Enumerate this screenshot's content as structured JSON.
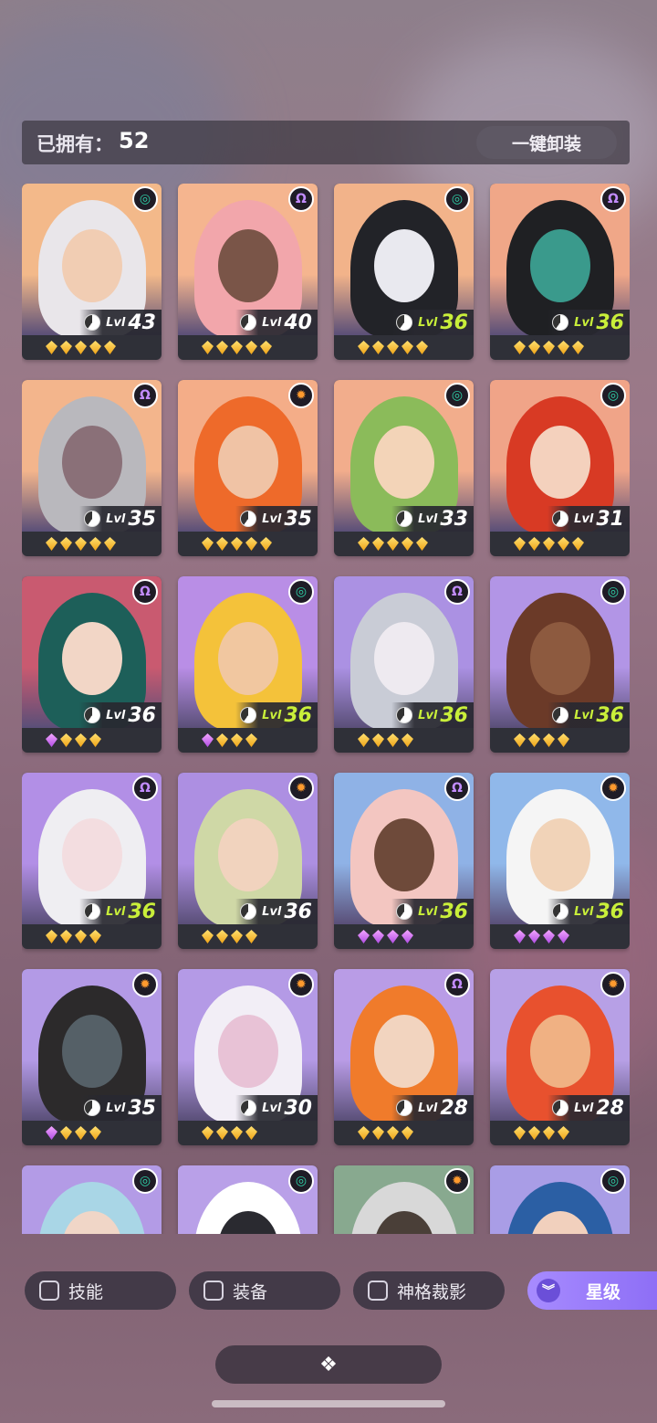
{
  "header": {
    "owned_label": "已拥有：",
    "owned_count": "52",
    "unequip_all": "一键卸装"
  },
  "faction_glyphs": {
    "green": "◎",
    "purple": "Ω",
    "orange": "✹"
  },
  "level_prefix": "Lvl",
  "heroes": [
    {
      "level": "43",
      "faction": "green",
      "max": false,
      "gems": [
        "gold",
        "gold",
        "gold",
        "gold",
        "gold"
      ],
      "bg": "#f3b98a",
      "hair": "#e9e6ea",
      "skin": "#f1cdb3"
    },
    {
      "level": "40",
      "faction": "purple",
      "max": false,
      "gems": [
        "gold",
        "gold",
        "gold",
        "gold",
        "gold"
      ],
      "bg": "#f5b58f",
      "hair": "#f2a6ab",
      "skin": "#7a5548"
    },
    {
      "level": "36",
      "faction": "green",
      "max": true,
      "gems": [
        "gold",
        "gold",
        "gold",
        "gold",
        "gold"
      ],
      "bg": "#f2b38a",
      "hair": "#222328",
      "skin": "#e9e9ef"
    },
    {
      "level": "36",
      "faction": "purple",
      "max": true,
      "gems": [
        "gold",
        "gold",
        "gold",
        "gold",
        "gold"
      ],
      "bg": "#f0a788",
      "hair": "#1f2023",
      "skin": "#3a9a8c"
    },
    {
      "level": "35",
      "faction": "purple",
      "max": false,
      "gems": [
        "gold",
        "gold",
        "gold",
        "gold",
        "gold"
      ],
      "bg": "#f3b58c",
      "hair": "#b9b8bd",
      "skin": "#8a7078"
    },
    {
      "level": "35",
      "faction": "orange",
      "max": false,
      "gems": [
        "gold",
        "gold",
        "gold",
        "gold",
        "gold"
      ],
      "bg": "#f4ad88",
      "hair": "#ee6a2a",
      "skin": "#f0c3a5"
    },
    {
      "level": "33",
      "faction": "green",
      "max": false,
      "gems": [
        "gold",
        "gold",
        "gold",
        "gold",
        "gold"
      ],
      "bg": "#f2ad8c",
      "hair": "#8bbb5a",
      "skin": "#f3d4b8"
    },
    {
      "level": "31",
      "faction": "green",
      "max": false,
      "gems": [
        "gold",
        "gold",
        "gold",
        "gold",
        "gold"
      ],
      "bg": "#f0a488",
      "hair": "#d83a24",
      "skin": "#f4d1bd"
    },
    {
      "level": "36",
      "faction": "purple",
      "max": false,
      "gems": [
        "purple",
        "gold",
        "gold",
        "gold"
      ],
      "bg": "#c95a70",
      "hair": "#1d5f59",
      "skin": "#f2d6c6"
    },
    {
      "level": "36",
      "faction": "green",
      "max": true,
      "gems": [
        "purple",
        "gold",
        "gold",
        "gold"
      ],
      "bg": "#b98ee6",
      "hair": "#f4c23a",
      "skin": "#f1c7a0"
    },
    {
      "level": "36",
      "faction": "purple",
      "max": true,
      "gems": [
        "gold",
        "gold",
        "gold",
        "gold"
      ],
      "bg": "#ab91e3",
      "hair": "#c9ccd6",
      "skin": "#eeeaf0"
    },
    {
      "level": "36",
      "faction": "green",
      "max": true,
      "gems": [
        "gold",
        "gold",
        "gold",
        "gold"
      ],
      "bg": "#b295e6",
      "hair": "#6b3a28",
      "skin": "#8d5a3f"
    },
    {
      "level": "36",
      "faction": "purple",
      "max": true,
      "gems": [
        "gold",
        "gold",
        "gold",
        "gold"
      ],
      "bg": "#b28fe6",
      "hair": "#efeef2",
      "skin": "#f3dde0"
    },
    {
      "level": "36",
      "faction": "orange",
      "max": false,
      "gems": [
        "gold",
        "gold",
        "gold",
        "gold"
      ],
      "bg": "#ad8fe2",
      "hair": "#cfd8a6",
      "skin": "#f1d3be"
    },
    {
      "level": "36",
      "faction": "purple",
      "max": true,
      "gems": [
        "purple",
        "purple",
        "purple",
        "purple"
      ],
      "bg": "#8fb2e6",
      "hair": "#f3c6c1",
      "skin": "#6e4a3a"
    },
    {
      "level": "36",
      "faction": "orange",
      "max": true,
      "gems": [
        "purple",
        "purple",
        "purple",
        "purple"
      ],
      "bg": "#90b8ea",
      "hair": "#f5f5f5",
      "skin": "#f1d3b8"
    },
    {
      "level": "35",
      "faction": "orange",
      "max": false,
      "gems": [
        "purple",
        "gold",
        "gold",
        "gold"
      ],
      "bg": "#b39ae6",
      "hair": "#2c2a2b",
      "skin": "#556067"
    },
    {
      "level": "30",
      "faction": "orange",
      "max": false,
      "gems": [
        "gold",
        "gold",
        "gold",
        "gold"
      ],
      "bg": "#b49ae6",
      "hair": "#f2eef6",
      "skin": "#e8c2d6"
    },
    {
      "level": "28",
      "faction": "purple",
      "max": false,
      "gems": [
        "gold",
        "gold",
        "gold",
        "gold"
      ],
      "bg": "#b99ce6",
      "hair": "#f07b2b",
      "skin": "#f2d4bf"
    },
    {
      "level": "28",
      "faction": "orange",
      "max": false,
      "gems": [
        "gold",
        "gold",
        "gold",
        "gold"
      ],
      "bg": "#b7a0e6",
      "hair": "#e8512e",
      "skin": "#f0b183"
    },
    {
      "level": "",
      "faction": "green",
      "max": false,
      "gems": [],
      "bg": "#b39be6",
      "hair": "#a9d6e6",
      "skin": "#f0d6c7"
    },
    {
      "level": "",
      "faction": "green",
      "max": false,
      "gems": [],
      "bg": "#b9a0e8",
      "hair": "#ffffff",
      "skin": "#2a2a30"
    },
    {
      "level": "",
      "faction": "orange",
      "max": false,
      "gems": [],
      "bg": "#88a98f",
      "hair": "#d8d8d8",
      "skin": "#4a3f38"
    },
    {
      "level": "",
      "faction": "green",
      "max": false,
      "gems": [],
      "bg": "#a99de6",
      "hair": "#2b5fa4",
      "skin": "#f1d0bd"
    }
  ],
  "filters": {
    "skill": "技能",
    "equipment": "装备",
    "god_shadow": "神格裁影",
    "star_sort": "星级"
  },
  "collapse_glyph": "❖"
}
